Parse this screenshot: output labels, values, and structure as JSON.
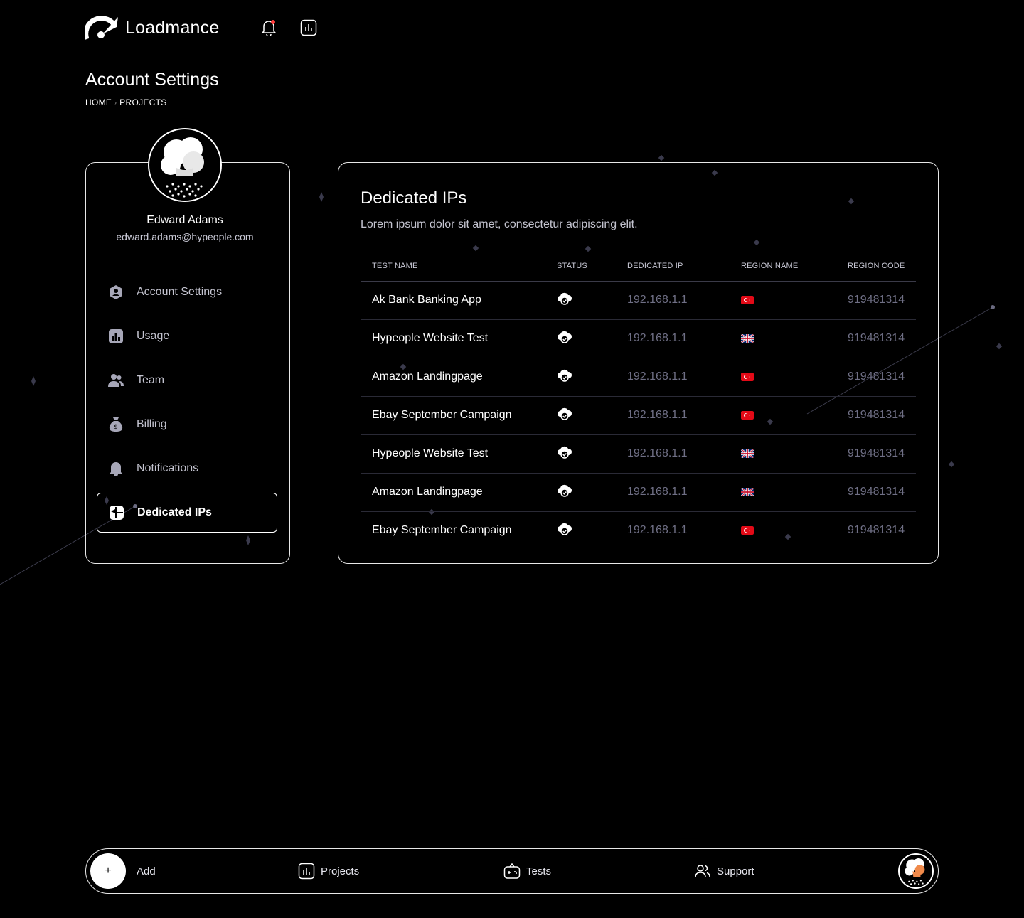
{
  "header": {
    "brand": "Loadmance",
    "icons": [
      "bell-icon",
      "chart-icon"
    ]
  },
  "page": {
    "title": "Account Settings",
    "breadcrumb": [
      "HOME",
      "PROJECTS"
    ],
    "breadcrumb_sep": "›"
  },
  "profile": {
    "name": "Edward Adams",
    "email": "edward.adams@hypeople.com"
  },
  "menu": {
    "items": [
      {
        "label": "Account Settings",
        "icon": "user-shield-icon"
      },
      {
        "label": "Usage",
        "icon": "bar-chart-icon"
      },
      {
        "label": "Team",
        "icon": "team-icon"
      },
      {
        "label": "Billing",
        "icon": "money-bag-icon"
      },
      {
        "label": "Notifications",
        "icon": "bell-icon"
      },
      {
        "label": "Dedicated IPs",
        "icon": "ip-icon",
        "active": true
      }
    ]
  },
  "ip_panel": {
    "title": "Dedicated IPs",
    "description": "Lorem ipsum dolor sit amet, consectetur adipiscing elit.",
    "columns": [
      "TEST NAME",
      "STATUS",
      "DEDICATED IP",
      "REGION NAME",
      "REGION CODE"
    ],
    "rows": [
      {
        "name": "Ak Bank Banking App",
        "ip": "192.168.1.1",
        "region": "tr",
        "code": "919481314"
      },
      {
        "name": "Hypeople Website Test",
        "ip": "192.168.1.1",
        "region": "uk",
        "code": "919481314"
      },
      {
        "name": "Amazon Landingpage",
        "ip": "192.168.1.1",
        "region": "tr",
        "code": "919481314"
      },
      {
        "name": "Ebay September Campaign",
        "ip": "192.168.1.1",
        "region": "tr",
        "code": "919481314"
      },
      {
        "name": "Hypeople Website Test",
        "ip": "192.168.1.1",
        "region": "uk",
        "code": "919481314"
      },
      {
        "name": "Amazon Landingpage",
        "ip": "192.168.1.1",
        "region": "uk",
        "code": "919481314"
      },
      {
        "name": "Ebay September Campaign",
        "ip": "192.168.1.1",
        "region": "tr",
        "code": "919481314"
      }
    ]
  },
  "bottombar": {
    "add_symbol": "+",
    "add_label": "Add",
    "projects_label": "Projects",
    "tests_label": "Tests",
    "support_label": "Support"
  },
  "colors": {
    "background": "#000000",
    "border": "#e8e8e8",
    "muted_text": "#6f6f85",
    "notification_dot": "#ff3b3b",
    "flag_tr": "#e30a17",
    "flag_uk_blue": "#012169",
    "flag_uk_red": "#c8102e"
  }
}
